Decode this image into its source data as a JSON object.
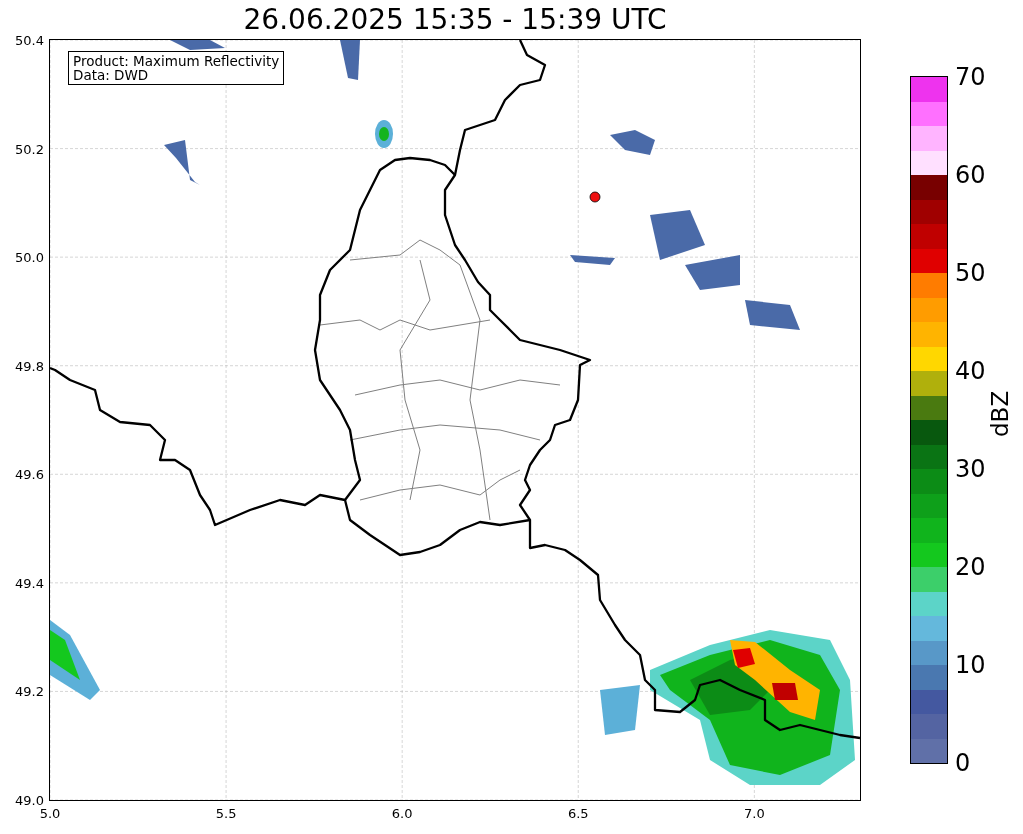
{
  "title": "26.06.2025 15:35 - 15:39 UTC",
  "info_box": [
    "Product: Maximum Reflectivity",
    "Data: DWD"
  ],
  "map": {
    "xticks": [
      "5.0",
      "5.5",
      "6.0",
      "6.5",
      "7.0"
    ],
    "yticks": [
      "50.4",
      "50.2",
      "50.0",
      "49.8",
      "49.6",
      "49.4",
      "49.2",
      "49.0"
    ]
  },
  "colorbar": {
    "label": "dBZ",
    "ticks": [
      "70",
      "60",
      "50",
      "40",
      "30",
      "20",
      "10",
      "0"
    ],
    "segments": [
      {
        "color": "#6070a8"
      },
      {
        "color": "#5464a2"
      },
      {
        "color": "#4458a0"
      },
      {
        "color": "#4a78b0"
      },
      {
        "color": "#5898c8"
      },
      {
        "color": "#64b8dc"
      },
      {
        "color": "#5cd4c8"
      },
      {
        "color": "#3ccf6a"
      },
      {
        "color": "#14c81e"
      },
      {
        "color": "#10b41c"
      },
      {
        "color": "#0ea01a"
      },
      {
        "color": "#0c8c16"
      },
      {
        "color": "#0a7414"
      },
      {
        "color": "#08580e"
      },
      {
        "color": "#4a7a10"
      },
      {
        "color": "#b0b00c"
      },
      {
        "color": "#ffd700"
      },
      {
        "color": "#ffb400"
      },
      {
        "color": "#ff9c00"
      },
      {
        "color": "#ff7c00"
      },
      {
        "color": "#e00000"
      },
      {
        "color": "#c00000"
      },
      {
        "color": "#a00000"
      },
      {
        "color": "#780000"
      },
      {
        "color": "#ffe0ff"
      },
      {
        "color": "#ffb4ff"
      },
      {
        "color": "#ff70ff"
      },
      {
        "color": "#ee33ee"
      }
    ]
  }
}
